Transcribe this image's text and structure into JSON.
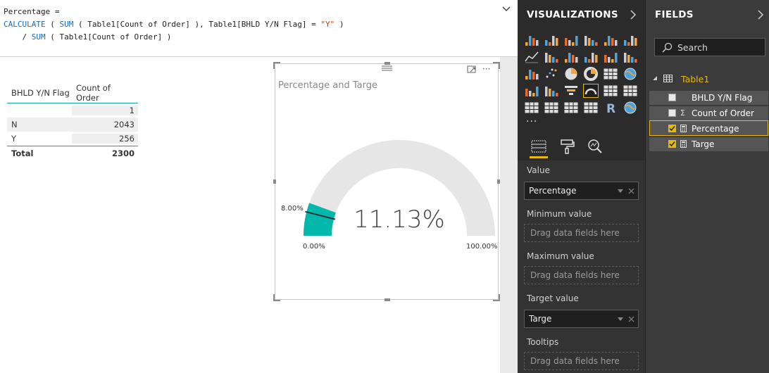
{
  "formula": {
    "line1": "Percentage =",
    "kw_calculate": "CALCULATE",
    "kw_sum": "SUM",
    "seg1": " ( Table1[Count of Order] ), Table1[BHLD Y/N Flag] = ",
    "str_y": "\"Y\"",
    "seg_close": " )",
    "seg_div": "    / ",
    "seg2": " ( Table1[Count of Order] )",
    "open_paren": " ( "
  },
  "table": {
    "headers": [
      "BHLD Y/N Flag",
      "Count of Order"
    ],
    "rows": [
      {
        "flag": "",
        "count": "1"
      },
      {
        "flag": "N",
        "count": "2043"
      },
      {
        "flag": "Y",
        "count": "256"
      }
    ],
    "total": {
      "label": "Total",
      "count": "2300"
    }
  },
  "gauge": {
    "title": "Percentage and Targe",
    "value_label": "11.13%",
    "target_label": "8.00%",
    "min_label": "0.00%",
    "max_label": "100.00%",
    "value": 11.13,
    "target": 8.0,
    "min": 0,
    "max": 100,
    "fill_color": "#01b8aa",
    "track_color": "#e6e6e6",
    "target_color": "#333333",
    "more_options": "···"
  },
  "visualizations": {
    "title": "VISUALIZATIONS",
    "more": "···",
    "wells": [
      {
        "label": "Value",
        "field": "Percentage"
      },
      {
        "label": "Minimum value",
        "placeholder": "Drag data fields here"
      },
      {
        "label": "Maximum value",
        "placeholder": "Drag data fields here"
      },
      {
        "label": "Target value",
        "field": "Targe"
      },
      {
        "label": "Tooltips",
        "placeholder": "Drag data fields here"
      }
    ],
    "r_glyph": "R"
  },
  "fields": {
    "title": "FIELDS",
    "search_placeholder": "Search",
    "table_name": "Table1",
    "items": [
      {
        "label": "BHLD Y/N Flag",
        "checked": false,
        "icon": "none"
      },
      {
        "label": "Count of Order",
        "checked": false,
        "icon": "sigma-icon",
        "glyph": "Σ"
      },
      {
        "label": "Percentage",
        "checked": true,
        "icon": "calculator-icon"
      },
      {
        "label": "Targe",
        "checked": true,
        "icon": "calculator-icon"
      }
    ],
    "accent": "#e8b80d"
  }
}
